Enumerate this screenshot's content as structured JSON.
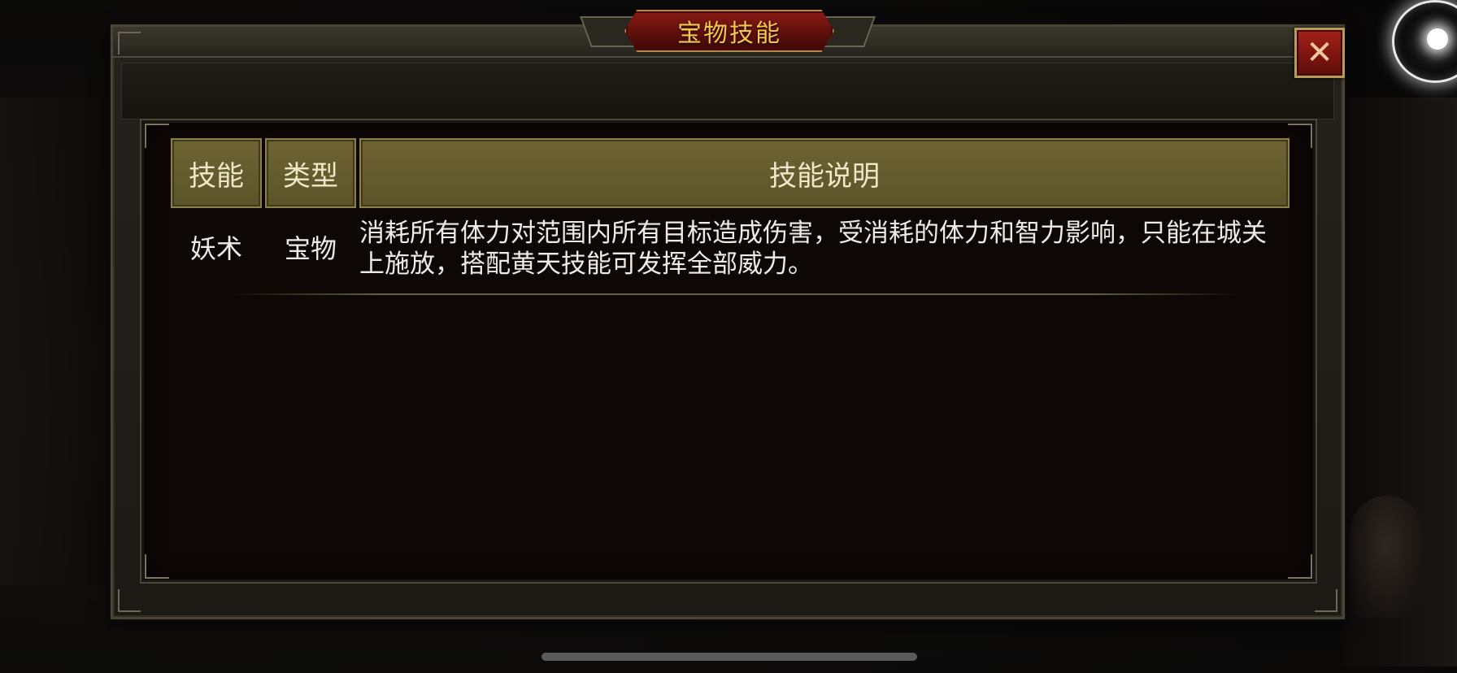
{
  "dialog": {
    "title": "宝物技能"
  },
  "table": {
    "headers": {
      "skill": "技能",
      "type": "类型",
      "description": "技能说明"
    },
    "rows": [
      {
        "skill": "妖术",
        "type": "宝物",
        "description": "消耗所有体力对范围内所有目标造成伤害，受消耗的体力和智力影响，只能在城关上施放，搭配黄天技能可发挥全部威力。"
      }
    ]
  },
  "icons": {
    "close": "close-icon",
    "assistive_touch": "floating-orb-icon"
  },
  "colors": {
    "title_text": "#f6c64a",
    "title_plaque": "#8a1a14",
    "header_bg": "#6e6433",
    "close_button": "#a3221a"
  }
}
